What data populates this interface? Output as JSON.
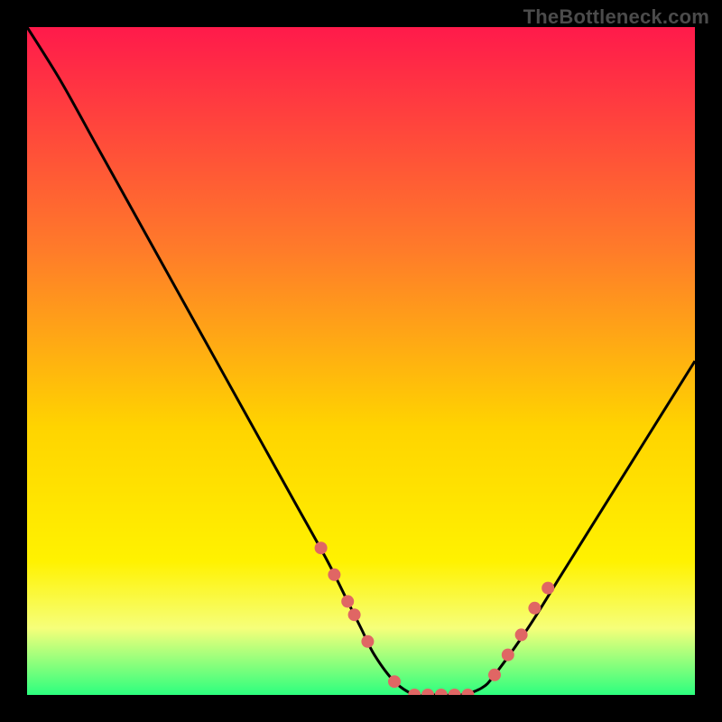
{
  "watermark": {
    "text": "TheBottleneck.com"
  },
  "colors": {
    "grad_top": "#ff1a4b",
    "grad_mid1": "#ff7a2a",
    "grad_mid2": "#ffd400",
    "grad_low1": "#fff200",
    "grad_low2": "#f6ff7a",
    "grad_bottom": "#2cff7e",
    "curve": "#000000",
    "marker": "#e06664",
    "bg": "#000000"
  },
  "chart_data": {
    "type": "line",
    "title": "",
    "xlabel": "",
    "ylabel": "",
    "xlim": [
      0,
      100
    ],
    "ylim": [
      0,
      100
    ],
    "series": [
      {
        "name": "bottleneck-curve",
        "x": [
          0,
          5,
          10,
          15,
          20,
          25,
          30,
          35,
          40,
          45,
          48,
          50,
          52,
          55,
          58,
          60,
          62,
          65,
          68,
          70,
          75,
          80,
          85,
          90,
          95,
          100
        ],
        "y": [
          100,
          92,
          83,
          74,
          65,
          56,
          47,
          38,
          29,
          20,
          14,
          10,
          6,
          2,
          0,
          0,
          0,
          0,
          1,
          3,
          10,
          18,
          26,
          34,
          42,
          50
        ]
      }
    ],
    "markers": {
      "name": "highlighted-points",
      "color_ref": "marker",
      "x": [
        44,
        46,
        48,
        49,
        51,
        55,
        58,
        60,
        62,
        64,
        66,
        70,
        72,
        74,
        76,
        78
      ],
      "y": [
        22,
        18,
        14,
        12,
        8,
        2,
        0,
        0,
        0,
        0,
        0,
        3,
        6,
        9,
        13,
        16
      ]
    },
    "gradient_stops": [
      {
        "offset": 0.0,
        "color_ref": "grad_top"
      },
      {
        "offset": 0.33,
        "color_ref": "grad_mid1"
      },
      {
        "offset": 0.6,
        "color_ref": "grad_mid2"
      },
      {
        "offset": 0.8,
        "color_ref": "grad_low1"
      },
      {
        "offset": 0.9,
        "color_ref": "grad_low2"
      },
      {
        "offset": 1.0,
        "color_ref": "grad_bottom"
      }
    ]
  }
}
